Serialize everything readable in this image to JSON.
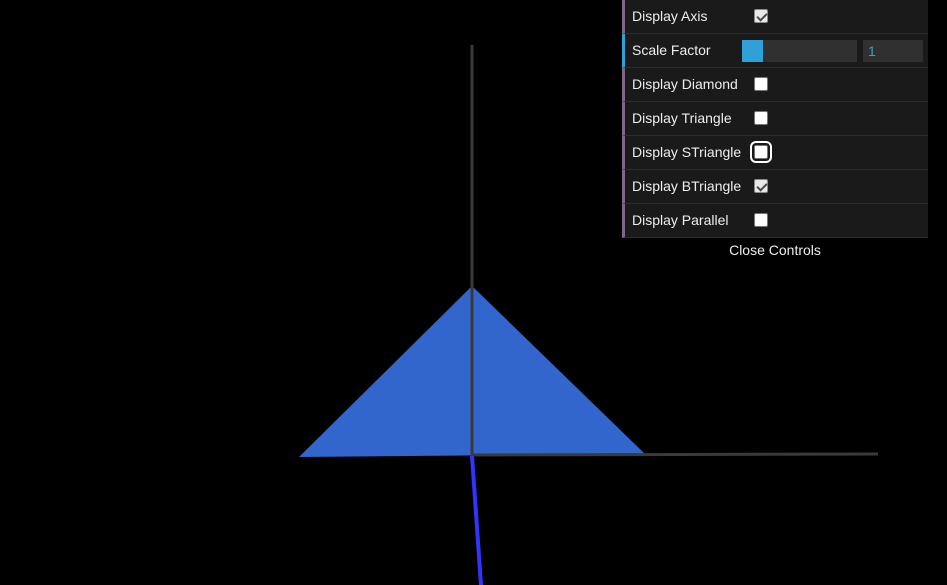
{
  "scene": {
    "background_color": "#000000",
    "triangle_color": "#3366cc",
    "axis_color": "#3a3a3a",
    "z_axis_color": "#3333ff"
  },
  "gui": {
    "accent_checkbox_row": "#806787",
    "accent_number_row": "#2fa1d6",
    "controls": [
      {
        "label": "Display Axis",
        "type": "checkbox",
        "checked": true
      },
      {
        "label": "Scale Factor",
        "type": "number",
        "value": "1",
        "slider_fraction": 0.18
      },
      {
        "label": "Display Diamond",
        "type": "checkbox",
        "checked": false
      },
      {
        "label": "Display Triangle",
        "type": "checkbox",
        "checked": false
      },
      {
        "label": "Display STriangle",
        "type": "checkbox",
        "checked": false,
        "focused": true
      },
      {
        "label": "Display BTriangle",
        "type": "checkbox",
        "checked": true
      },
      {
        "label": "Display Parallel",
        "type": "checkbox",
        "checked": false
      }
    ],
    "close_label": "Close Controls"
  }
}
